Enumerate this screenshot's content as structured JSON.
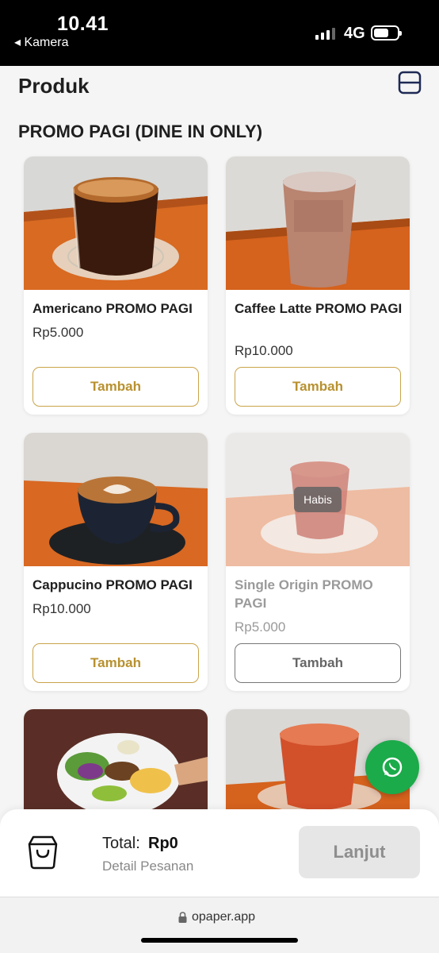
{
  "status_bar": {
    "time": "10.41",
    "back_label": "◂ Kamera",
    "network": "4G"
  },
  "header": {
    "title": "Produk",
    "layout_toggle_icon": "layout-toggle-icon"
  },
  "section": {
    "title": "PROMO PAGI (DINE IN ONLY)"
  },
  "products": [
    {
      "name": "Americano PROMO PAGI",
      "price": "Rp5.000",
      "button": "Tambah",
      "available": true
    },
    {
      "name": "Caffee Latte PROMO PAGI",
      "price": "Rp10.000",
      "button": "Tambah",
      "available": true
    },
    {
      "name": "Cappucino PROMO PAGI",
      "price": "Rp10.000",
      "button": "Tambah",
      "available": true
    },
    {
      "name": "Single Origin PROMO PAGI",
      "price": "Rp5.000",
      "button": "Tambah",
      "available": false,
      "badge": "Habis"
    },
    {
      "name": "",
      "price": "",
      "button": "",
      "available": true
    },
    {
      "name": "",
      "price": "",
      "button": "",
      "available": true
    }
  ],
  "cart": {
    "total_label": "Total:",
    "total_value": "Rp0",
    "detail_link": "Detail Pesanan",
    "continue_button": "Lanjut"
  },
  "browser": {
    "url": "opaper.app"
  },
  "colors": {
    "accent": "#c9a44a",
    "whatsapp": "#1bab4a",
    "disabled_button": "#e6e6e6"
  }
}
